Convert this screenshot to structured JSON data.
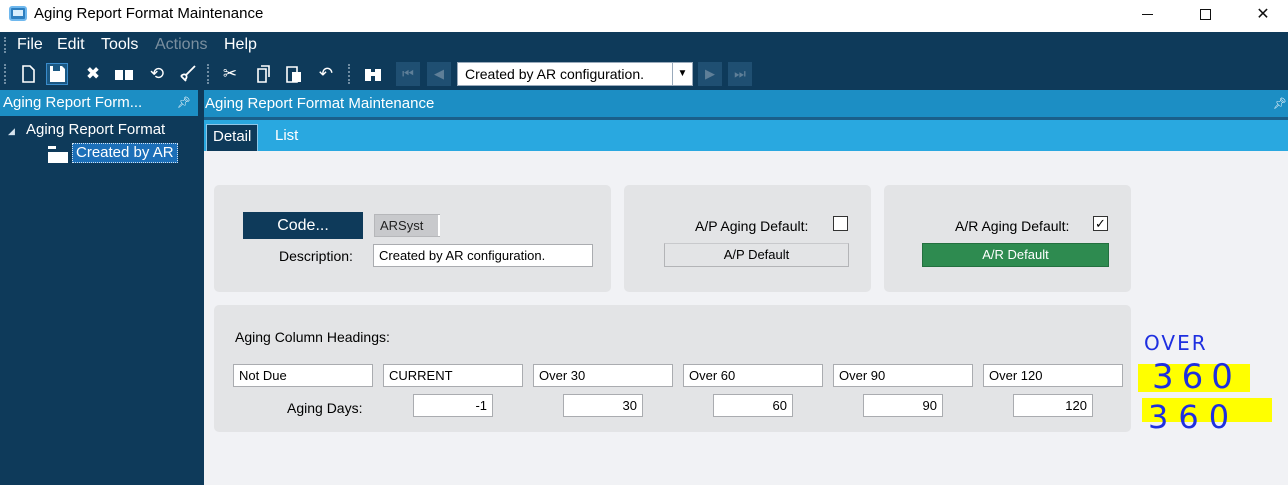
{
  "window": {
    "title": "Aging Report Format Maintenance",
    "controls": [
      "minimize",
      "maximize",
      "close"
    ]
  },
  "menu": {
    "items": [
      {
        "label": "File",
        "enabled": true
      },
      {
        "label": "Edit",
        "enabled": true
      },
      {
        "label": "Tools",
        "enabled": true
      },
      {
        "label": "Actions",
        "enabled": false
      },
      {
        "label": "Help",
        "enabled": true
      }
    ]
  },
  "toolbar": {
    "icons": [
      "new-icon",
      "save-icon",
      "delete-icon",
      "open-book-icon",
      "refresh-icon",
      "clear-brush-icon",
      "cut-icon",
      "copy-icon",
      "paste-icon",
      "undo-icon",
      "binoculars-icon",
      "first-record-icon",
      "previous-record-icon",
      "next-record-icon",
      "last-record-icon"
    ],
    "record_selector": "Created by AR configuration."
  },
  "tree_panel": {
    "header": "Aging Report Form...",
    "root": "Aging Report Format",
    "child": "Created by AR"
  },
  "main_panel": {
    "header": "Aging Report Format Maintenance",
    "tabs": [
      {
        "label": "Detail",
        "active": true
      },
      {
        "label": "List",
        "active": false
      }
    ]
  },
  "form": {
    "code_button": "Code...",
    "code_value": "ARSyst",
    "description_label": "Description:",
    "description_value": "Created by AR configuration.",
    "ap_default_label": "A/P Aging Default:",
    "ap_default_checked": false,
    "ap_default_button": "A/P Default",
    "ar_default_label": "A/R Aging Default:",
    "ar_default_checked": true,
    "ar_default_button": "A/R Default",
    "ar_default_button_color": "#2e8b50",
    "aging_headings_label": "Aging Column Headings:",
    "headings": [
      "Not Due",
      "CURRENT",
      "Over 30",
      "Over 60",
      "Over 90",
      "Over 120"
    ],
    "aging_days_label": "Aging Days:",
    "days": [
      "-1",
      "30",
      "60",
      "90",
      "120"
    ]
  },
  "annotation": {
    "lines": [
      "OVER",
      "360",
      "360"
    ],
    "ink_color": "#1e2fe0",
    "highlight_color": "#ffff00"
  },
  "colors": {
    "navy": "#0e3a5a",
    "header_blue": "#1c8ec4",
    "tab_blue": "#29a8e0"
  }
}
